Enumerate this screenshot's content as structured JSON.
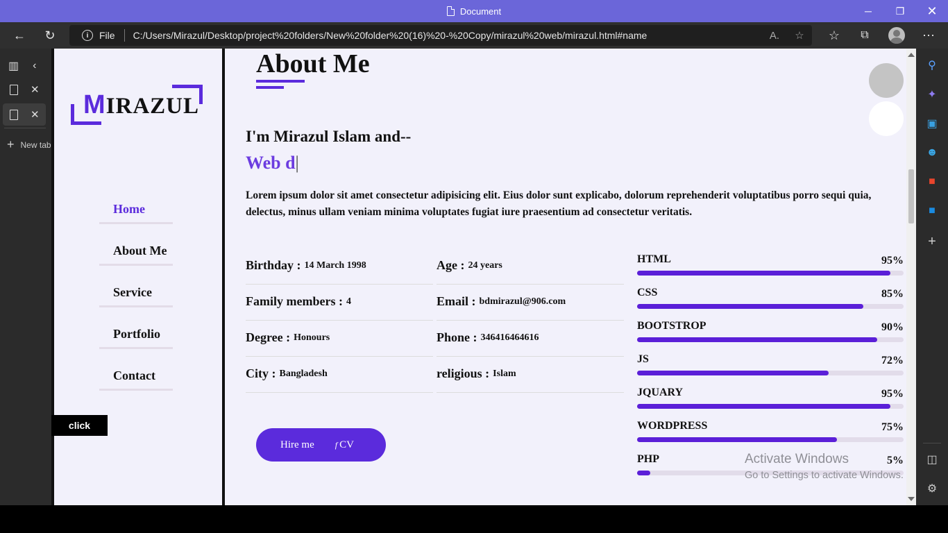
{
  "window": {
    "title": "Document"
  },
  "browser": {
    "scheme_label": "File",
    "url": "C:/Users/Mirazul/Desktop/project%20folders/New%20folder%20(16)%20-%20Copy/mirazul%20web/mirazul.html#name",
    "new_tab_label": "New tab"
  },
  "site": {
    "logo_first": "M",
    "logo_rest": "IRAZUL",
    "nav": [
      "Home",
      "About Me",
      "Service",
      "Portfolio",
      "Contact"
    ],
    "click_label": "click",
    "about_title": "About Me",
    "intro": "I'm Mirazul Islam and--",
    "typing": "Web d",
    "cursor": "|",
    "description": "Lorem ipsum dolor sit amet consectetur adipisicing elit. Eius dolor sunt explicabo, dolorum reprehenderit voluptatibus porro sequi quia, delectus, minus ullam veniam minima voluptates fugiat iure praesentium ad consectetur veritatis.",
    "info": [
      {
        "key": "Birthday :",
        "value": "14 March 1998"
      },
      {
        "key": "Age :",
        "value": "24 years"
      },
      {
        "key": "Family members :",
        "value": "4"
      },
      {
        "key": "Email :",
        "value": "bdmirazul@906.com"
      },
      {
        "key": "Degree :",
        "value": "Honours"
      },
      {
        "key": "Phone :",
        "value": "346416464616"
      },
      {
        "key": "City :",
        "value": "Bangladesh"
      },
      {
        "key": "religious :",
        "value": "Islam"
      }
    ],
    "hire_label": "Hire me",
    "cv_icon": "f",
    "cv_label": "CV",
    "skills": [
      {
        "name": "HTML",
        "percent_label": "95%",
        "level": 95
      },
      {
        "name": "CSS",
        "percent_label": "85%",
        "level": 85
      },
      {
        "name": "BOOTSTROP",
        "percent_label": "90%",
        "level": 90
      },
      {
        "name": "JS",
        "percent_label": "72%",
        "level": 72
      },
      {
        "name": "JQUARY",
        "percent_label": "95%",
        "level": 95
      },
      {
        "name": "WORDPRESS",
        "percent_label": "75%",
        "level": 75
      },
      {
        "name": "PHP",
        "percent_label": "5%",
        "level": 5
      }
    ]
  },
  "watermark": {
    "line1": "Activate Windows",
    "line2": "Go to Settings to activate Windows."
  },
  "colors": {
    "accent": "#5b2bdc",
    "titlebar": "#6b66d9",
    "page_bg": "#f2f1fb"
  }
}
